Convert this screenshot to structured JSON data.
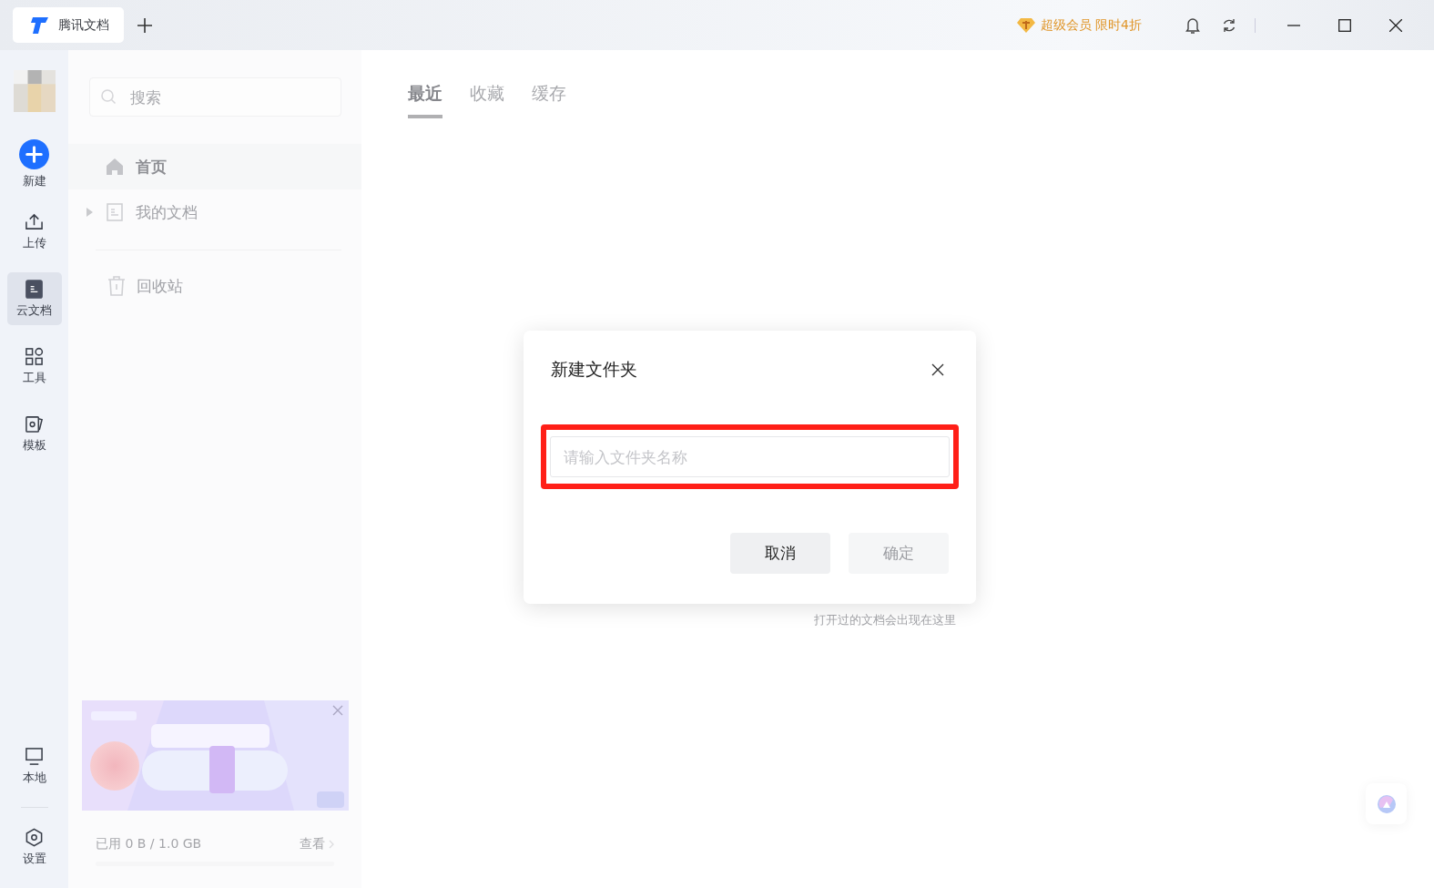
{
  "title_bar": {
    "tab": {
      "title": "腾讯文档"
    },
    "promo": "超级会员 限时4折"
  },
  "rail": {
    "items": [
      {
        "label": "新建",
        "kind": "new",
        "selected": false
      },
      {
        "label": "上传",
        "kind": "upload",
        "selected": false
      },
      {
        "label": "云文档",
        "kind": "cloud",
        "selected": true
      },
      {
        "label": "工具",
        "kind": "tools",
        "selected": false
      },
      {
        "label": "模板",
        "kind": "template",
        "selected": false
      }
    ],
    "bottom_items": [
      {
        "label": "本地",
        "kind": "local",
        "selected": false
      },
      {
        "label": "设置",
        "kind": "settings",
        "selected": false
      }
    ]
  },
  "sidebar": {
    "search": {
      "placeholder": "搜索"
    },
    "nav": [
      {
        "label": "首页",
        "kind": "home",
        "selected": true
      },
      {
        "label": "我的文档",
        "kind": "docs",
        "selected": false
      }
    ],
    "trash": {
      "label": "回收站"
    },
    "storage": {
      "used": "已用 0 B / 1.0 GB",
      "link": "查看"
    }
  },
  "tabs": [
    {
      "label": "最近",
      "selected": true
    },
    {
      "label": "收藏",
      "selected": false
    },
    {
      "label": "缓存",
      "selected": false
    }
  ],
  "empty_hint": "打开过的文档会出现在这里",
  "dialog": {
    "title": "新建文件夹",
    "field": {
      "placeholder": "请输入文件夹名称"
    },
    "highlighted": true,
    "buttons": [
      {
        "label": "取消",
        "disabled": false
      },
      {
        "label": "确定",
        "disabled": true
      }
    ]
  }
}
